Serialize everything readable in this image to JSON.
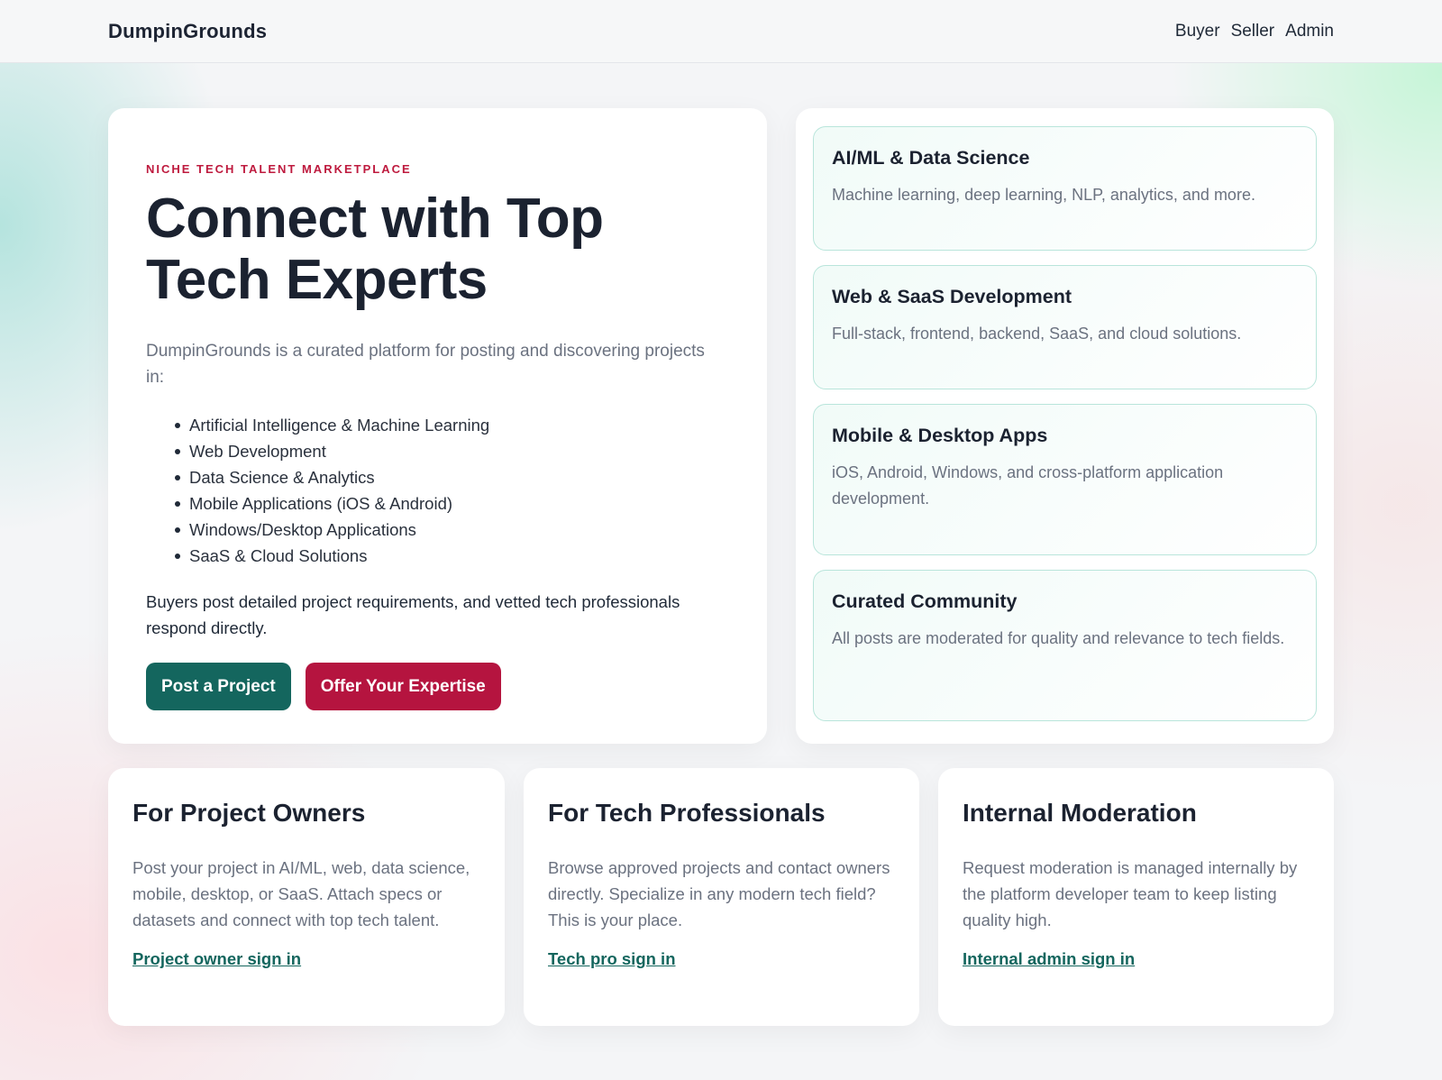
{
  "header": {
    "brand": "DumpinGrounds",
    "nav": [
      "Buyer",
      "Seller",
      "Admin"
    ]
  },
  "hero": {
    "eyebrow": "NICHE TECH TALENT MARKETPLACE",
    "title_line1": "Connect with Top",
    "title_line2": "Tech Experts",
    "intro": "DumpinGrounds is a curated platform for posting and discovering projects in:",
    "list": [
      "Artificial Intelligence & Machine Learning",
      "Web Development",
      "Data Science & Analytics",
      "Mobile Applications (iOS & Android)",
      "Windows/Desktop Applications",
      "SaaS & Cloud Solutions"
    ],
    "outro": "Buyers post detailed project requirements, and vetted tech professionals respond directly.",
    "primary_button": "Post a Project",
    "secondary_button": "Offer Your Expertise"
  },
  "features": [
    {
      "title": "AI/ML & Data Science",
      "desc": "Machine learning, deep learning, NLP, analytics, and more."
    },
    {
      "title": "Web & SaaS Development",
      "desc": "Full-stack, frontend, backend, SaaS, and cloud solutions."
    },
    {
      "title": "Mobile & Desktop Apps",
      "desc": "iOS, Android, Windows, and cross-platform application development."
    },
    {
      "title": "Curated Community",
      "desc": "All posts are moderated for quality and relevance to tech fields."
    }
  ],
  "info_cards": [
    {
      "title": "For Project Owners",
      "desc": "Post your project in AI/ML, web, data science, mobile, desktop, or SaaS. Attach specs or datasets and connect with top tech talent.",
      "link": "Project owner sign in"
    },
    {
      "title": "For Tech Professionals",
      "desc": "Browse approved projects and contact owners directly. Specialize in any modern tech field? This is your place.",
      "link": "Tech pro sign in"
    },
    {
      "title": "Internal Moderation",
      "desc": "Request moderation is managed internally by the platform developer team to keep listing quality high.",
      "link": "Internal admin sign in"
    }
  ],
  "colors": {
    "accent_teal": "#14665e",
    "accent_crimson": "#b5143f"
  }
}
